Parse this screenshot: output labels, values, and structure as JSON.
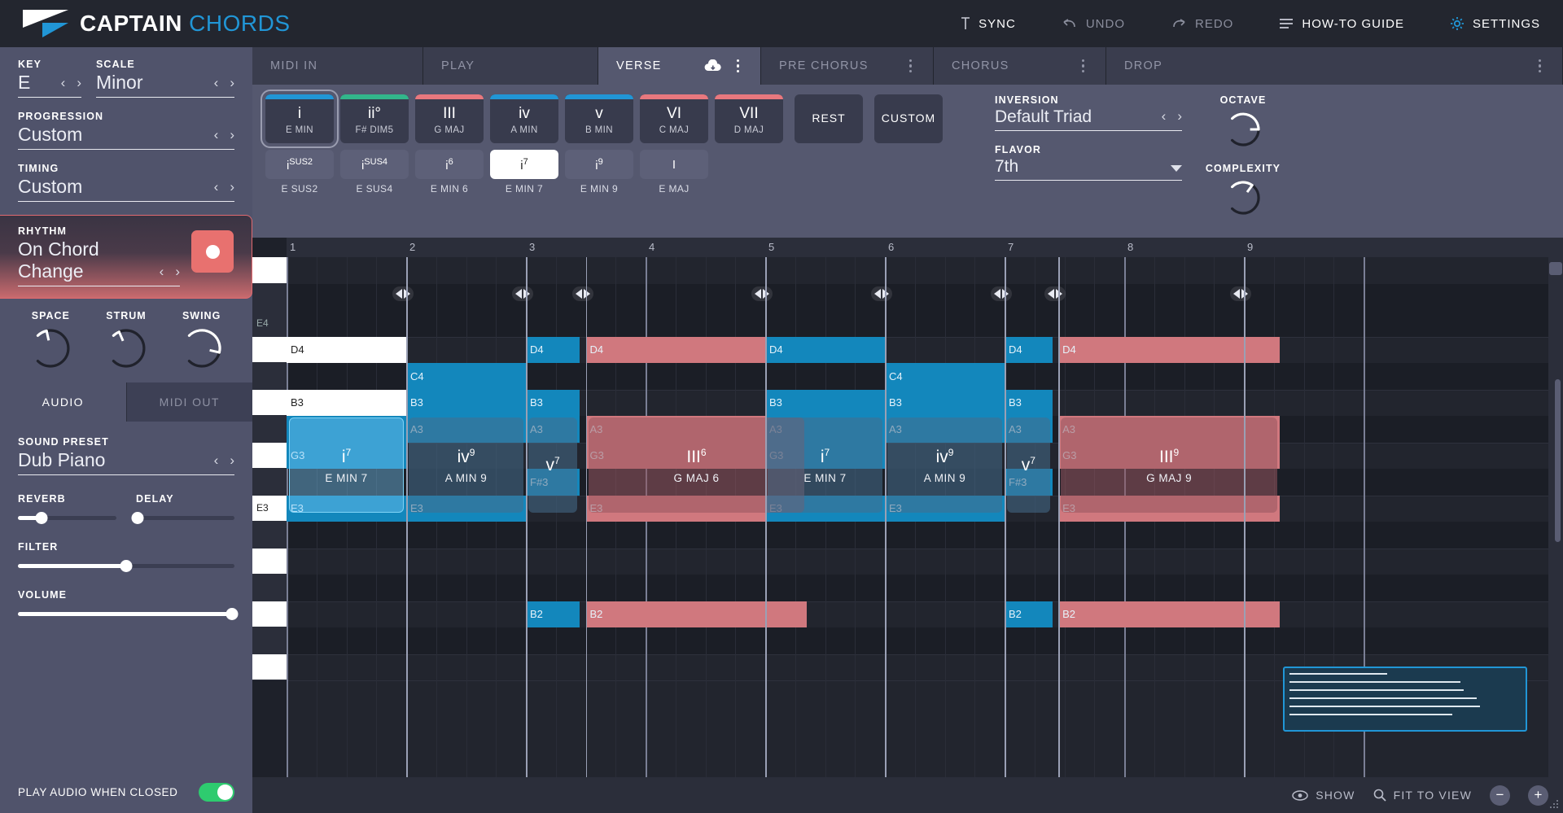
{
  "app": {
    "brand_bold": "CAPTAIN",
    "brand_light": "CHORDS",
    "accent": "#2196d6"
  },
  "topbar": {
    "sync": "SYNC",
    "undo": "UNDO",
    "redo": "REDO",
    "howto": "HOW-TO GUIDE",
    "settings": "SETTINGS"
  },
  "sidebar": {
    "key_label": "KEY",
    "key_value": "E",
    "scale_label": "SCALE",
    "scale_value": "Minor",
    "progression_label": "PROGRESSION",
    "progression_value": "Custom",
    "timing_label": "TIMING",
    "timing_value": "Custom",
    "rhythm_label": "RHYTHM",
    "rhythm_value": "On Chord Change",
    "knobs": [
      {
        "label": "SPACE",
        "value": 12
      },
      {
        "label": "STRUM",
        "value": 8
      },
      {
        "label": "SWING",
        "value": 55
      }
    ],
    "tabs": [
      {
        "label": "AUDIO",
        "active": true
      },
      {
        "label": "MIDI OUT",
        "active": false
      }
    ],
    "sound_preset_label": "SOUND PRESET",
    "sound_preset_value": "Dub Piano",
    "reverb_label": "REVERB",
    "reverb_value": 24,
    "delay_label": "DELAY",
    "delay_value": 2,
    "filter_label": "FILTER",
    "filter_value": 50,
    "volume_label": "VOLUME",
    "volume_value": 99,
    "play_closed_label": "PLAY AUDIO WHEN CLOSED",
    "play_closed_on": true
  },
  "sections": [
    {
      "label": "MIDI IN",
      "state": "plain"
    },
    {
      "label": "PLAY",
      "state": "play"
    },
    {
      "label": "VERSE",
      "state": "active"
    },
    {
      "label": "PRE CHORUS",
      "state": "sec"
    },
    {
      "label": "CHORUS",
      "state": "sec"
    },
    {
      "label": "DROP",
      "state": "last"
    }
  ],
  "chords": [
    {
      "roman": "i",
      "name": "E MIN",
      "cap": "#2196d6"
    },
    {
      "roman": "ii°",
      "name": "F# DIM5",
      "cap": "#32b68b"
    },
    {
      "roman": "III",
      "name": "G MAJ",
      "cap": "#e8787e"
    },
    {
      "roman": "iv",
      "name": "A MIN",
      "cap": "#2196d6"
    },
    {
      "roman": "v",
      "name": "B MIN",
      "cap": "#2196d6"
    },
    {
      "roman": "VI",
      "name": "C MAJ",
      "cap": "#e8787e"
    },
    {
      "roman": "VII",
      "name": "D MAJ",
      "cap": "#e8787e"
    }
  ],
  "extra_buttons": [
    {
      "label": "REST"
    },
    {
      "label": "CUSTOM"
    }
  ],
  "variations": [
    {
      "roman": "i",
      "sup": "SUS2",
      "name": "E SUS2",
      "selected": false
    },
    {
      "roman": "i",
      "sup": "SUS4",
      "name": "E SUS4",
      "selected": false
    },
    {
      "roman": "i",
      "sup": "6",
      "name": "E MIN 6",
      "selected": false
    },
    {
      "roman": "i",
      "sup": "7",
      "name": "E MIN 7",
      "selected": true
    },
    {
      "roman": "i",
      "sup": "9",
      "name": "E MIN 9",
      "selected": false
    },
    {
      "roman": "I",
      "sup": "",
      "name": "E MAJ",
      "selected": false
    }
  ],
  "params": {
    "inversion_label": "INVERSION",
    "inversion_value": "Default Triad",
    "flavor_label": "FLAVOR",
    "flavor_value": "7th",
    "octave_label": "OCTAVE",
    "octave_value": 50,
    "complexity_label": "COMPLEXITY",
    "complexity_value": 30
  },
  "roll": {
    "bars": [
      "1",
      "2",
      "3",
      "4",
      "5",
      "6",
      "7",
      "8",
      "9"
    ],
    "key_labels": [
      {
        "row": 2,
        "label": "E4"
      },
      {
        "row": 9,
        "label": "E3"
      }
    ],
    "notes": [
      {
        "row": 3,
        "bar": 1.0,
        "len": 1.0,
        "label": "D4",
        "color": "white"
      },
      {
        "row": 3,
        "bar": 3.0,
        "len": 0.45,
        "label": "D4",
        "color": "blue"
      },
      {
        "row": 3,
        "bar": 3.5,
        "len": 1.85,
        "label": "D4",
        "color": "red"
      },
      {
        "row": 3,
        "bar": 5.0,
        "len": 1.0,
        "label": "D4",
        "color": "blue"
      },
      {
        "row": 3,
        "bar": 7.0,
        "len": 0.4,
        "label": "D4",
        "color": "blue"
      },
      {
        "row": 3,
        "bar": 7.45,
        "len": 1.85,
        "label": "D4",
        "color": "red"
      },
      {
        "row": 4,
        "bar": 2.0,
        "len": 1.0,
        "label": "C4",
        "color": "blue"
      },
      {
        "row": 4,
        "bar": 6.0,
        "len": 1.0,
        "label": "C4",
        "color": "blue"
      },
      {
        "row": 5,
        "bar": 1.0,
        "len": 1.0,
        "label": "B3",
        "color": "white"
      },
      {
        "row": 5,
        "bar": 2.0,
        "len": 1.0,
        "label": "B3",
        "color": "blue"
      },
      {
        "row": 5,
        "bar": 3.0,
        "len": 0.45,
        "label": "B3",
        "color": "blue"
      },
      {
        "row": 5,
        "bar": 5.0,
        "len": 1.0,
        "label": "B3",
        "color": "blue"
      },
      {
        "row": 5,
        "bar": 6.0,
        "len": 1.0,
        "label": "B3",
        "color": "blue"
      },
      {
        "row": 5,
        "bar": 7.0,
        "len": 0.4,
        "label": "B3",
        "color": "blue"
      },
      {
        "row": 6,
        "bar": 1.0,
        "len": 1.0,
        "label": "",
        "color": "blue"
      },
      {
        "row": 6,
        "bar": 2.0,
        "len": 1.0,
        "label": "A3",
        "color": "blue"
      },
      {
        "row": 6,
        "bar": 3.0,
        "len": 0.45,
        "label": "A3",
        "color": "blue"
      },
      {
        "row": 6,
        "bar": 3.5,
        "len": 1.85,
        "label": "A3",
        "color": "red"
      },
      {
        "row": 6,
        "bar": 5.0,
        "len": 1.0,
        "label": "A3",
        "color": "blue"
      },
      {
        "row": 6,
        "bar": 6.0,
        "len": 1.0,
        "label": "A3",
        "color": "blue"
      },
      {
        "row": 6,
        "bar": 7.0,
        "len": 0.4,
        "label": "A3",
        "color": "blue"
      },
      {
        "row": 6,
        "bar": 7.45,
        "len": 1.85,
        "label": "A3",
        "color": "red"
      },
      {
        "row": 7,
        "bar": 1.0,
        "len": 1.0,
        "label": "G3",
        "color": "blue"
      },
      {
        "row": 7,
        "bar": 3.5,
        "len": 1.85,
        "label": "G3",
        "color": "red"
      },
      {
        "row": 7,
        "bar": 5.0,
        "len": 1.0,
        "label": "G3",
        "color": "blue"
      },
      {
        "row": 7,
        "bar": 7.45,
        "len": 1.85,
        "label": "G3",
        "color": "red"
      },
      {
        "row": 8,
        "bar": 3.0,
        "len": 0.45,
        "label": "F#3",
        "color": "blue"
      },
      {
        "row": 8,
        "bar": 7.0,
        "len": 0.4,
        "label": "F#3",
        "color": "blue"
      },
      {
        "row": 9,
        "bar": 1.0,
        "len": 1.0,
        "label": "E3",
        "color": "blue"
      },
      {
        "row": 9,
        "bar": 2.0,
        "len": 1.0,
        "label": "E3",
        "color": "blue"
      },
      {
        "row": 9,
        "bar": 3.5,
        "len": 1.85,
        "label": "E3",
        "color": "red"
      },
      {
        "row": 9,
        "bar": 5.0,
        "len": 1.0,
        "label": "E3",
        "color": "blue"
      },
      {
        "row": 9,
        "bar": 6.0,
        "len": 1.0,
        "label": "E3",
        "color": "blue"
      },
      {
        "row": 9,
        "bar": 7.45,
        "len": 1.85,
        "label": "E3",
        "color": "red"
      },
      {
        "row": 13,
        "bar": 3.0,
        "len": 0.45,
        "label": "B2",
        "color": "blue"
      },
      {
        "row": 13,
        "bar": 3.5,
        "len": 1.85,
        "label": "B2",
        "color": "red"
      },
      {
        "row": 13,
        "bar": 7.0,
        "len": 0.4,
        "label": "B2",
        "color": "blue"
      },
      {
        "row": 13,
        "bar": 7.45,
        "len": 1.85,
        "label": "B2",
        "color": "red"
      }
    ],
    "chord_blocks": [
      {
        "bar": 1.0,
        "len": 1.0,
        "roman": "i",
        "sup": "7",
        "name": "E MIN 7",
        "style": "sel"
      },
      {
        "bar": 2.0,
        "len": 1.0,
        "roman": "iv",
        "sup": "9",
        "name": "A MIN 9",
        "style": "bluish"
      },
      {
        "bar": 3.0,
        "len": 0.45,
        "roman": "v",
        "sup": "7",
        "name": "",
        "style": "bluish"
      },
      {
        "bar": 3.5,
        "len": 1.85,
        "roman": "III",
        "sup": "6",
        "name": "G MAJ 6",
        "style": "reddish"
      },
      {
        "bar": 5.0,
        "len": 1.0,
        "roman": "i",
        "sup": "7",
        "name": "E MIN 7",
        "style": "bluish"
      },
      {
        "bar": 6.0,
        "len": 1.0,
        "roman": "iv",
        "sup": "9",
        "name": "A MIN 9",
        "style": "bluish"
      },
      {
        "bar": 7.0,
        "len": 0.4,
        "roman": "v",
        "sup": "7",
        "name": "",
        "style": "bluish"
      },
      {
        "bar": 7.45,
        "len": 1.85,
        "roman": "III",
        "sup": "9",
        "name": "G MAJ 9",
        "style": "reddish"
      }
    ],
    "nav_handles": [
      2.0,
      3.0,
      3.5,
      5.0,
      6.0,
      7.0,
      7.45,
      9.0
    ]
  },
  "bottombar": {
    "show": "SHOW",
    "fit": "FIT TO VIEW",
    "zoom_out": "−",
    "zoom_in": "+"
  }
}
